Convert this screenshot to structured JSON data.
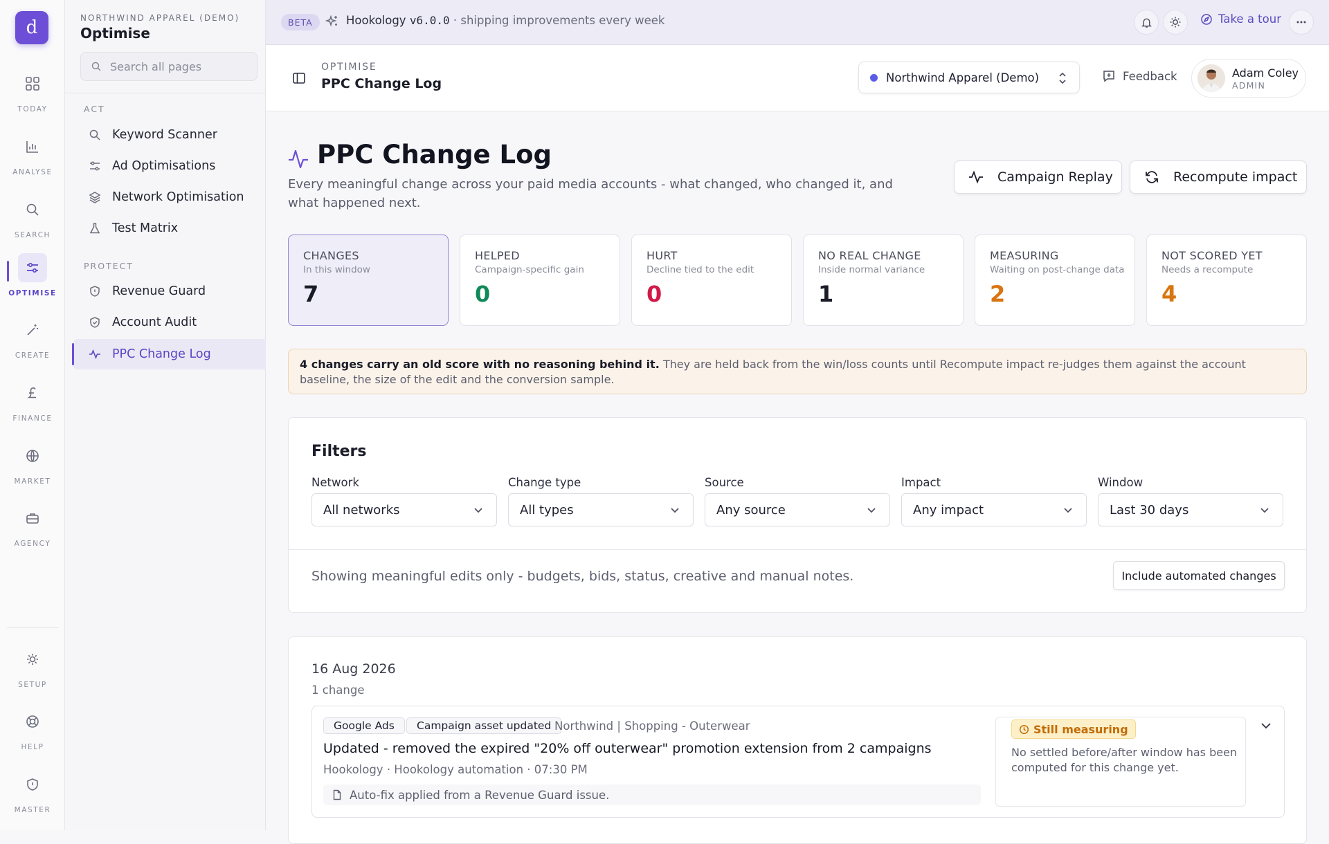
{
  "rail": {
    "logo_letter": "d",
    "items": [
      {
        "label": "TODAY",
        "icon": "grid-icon"
      },
      {
        "label": "ANALYSE",
        "icon": "bar-chart-icon"
      },
      {
        "label": "SEARCH",
        "icon": "search-icon"
      },
      {
        "label": "OPTIMISE",
        "icon": "sliders-icon"
      },
      {
        "label": "CREATE",
        "icon": "wand-icon"
      },
      {
        "label": "FINANCE",
        "icon": "pound-icon"
      },
      {
        "label": "MARKET",
        "icon": "globe-icon"
      },
      {
        "label": "AGENCY",
        "icon": "briefcase-icon"
      },
      {
        "label": "SETUP",
        "icon": "sun-gear-icon"
      },
      {
        "label": "HELP",
        "icon": "lifebuoy-icon"
      },
      {
        "label": "MASTER",
        "icon": "shield-icon"
      }
    ]
  },
  "sidebar": {
    "org": "NORTHWIND APPAREL (DEMO)",
    "section": "Optimise",
    "search_placeholder": "Search all pages",
    "groups": [
      {
        "title": "ACT",
        "items": [
          "Keyword Scanner",
          "Ad Optimisations",
          "Network Optimisation",
          "Test Matrix"
        ]
      },
      {
        "title": "PROTECT",
        "items": [
          "Revenue Guard",
          "Account Audit",
          "PPC Change Log"
        ]
      }
    ],
    "active_item": "PPC Change Log"
  },
  "topbar": {
    "badge": "BETA",
    "brand": "Hookology",
    "version": "v6.0.0",
    "tagline": " · shipping improvements every week",
    "tour": "Take a tour"
  },
  "header": {
    "eyebrow": "OPTIMISE",
    "title": "PPC Change Log",
    "account": "Northwind Apparel (Demo)",
    "feedback": "Feedback",
    "user_name": "Adam Coley",
    "user_role": "ADMIN"
  },
  "page": {
    "title": "PPC Change Log",
    "description": "Every meaningful change across your paid media accounts - what changed, who changed it, and what happened next.",
    "btn_replay": "Campaign Replay",
    "btn_recompute": "Recompute impact"
  },
  "stats": [
    {
      "label": "CHANGES",
      "sub": "In this window",
      "value": "7",
      "color": "#191b27"
    },
    {
      "label": "HELPED",
      "sub": "Campaign-specific gain",
      "value": "0",
      "color": "#12895a"
    },
    {
      "label": "HURT",
      "sub": "Decline tied to the edit",
      "value": "0",
      "color": "#d11a48"
    },
    {
      "label": "NO REAL CHANGE",
      "sub": "Inside normal variance",
      "value": "1",
      "color": "#191b27"
    },
    {
      "label": "MEASURING",
      "sub": "Waiting on post-change data",
      "value": "2",
      "color": "#d97510"
    },
    {
      "label": "NOT SCORED YET",
      "sub": "Needs a recompute",
      "value": "4",
      "color": "#d97510"
    }
  ],
  "notice": {
    "bold": "4 changes carry an old score with no reasoning behind it.",
    "text": " They are held back from the win/loss counts until Recompute impact re-judges them against the account baseline, the size of the edit and the conversion sample."
  },
  "filters": {
    "title": "Filters",
    "fields": [
      {
        "label": "Network",
        "value": "All networks"
      },
      {
        "label": "Change type",
        "value": "All types"
      },
      {
        "label": "Source",
        "value": "Any source"
      },
      {
        "label": "Impact",
        "value": "Any impact"
      },
      {
        "label": "Window",
        "value": "Last 30 days"
      }
    ],
    "note": "Showing meaningful edits only - budgets, bids, status, creative and manual notes.",
    "include_btn": "Include automated changes"
  },
  "log": {
    "date": "16 Aug 2026",
    "count": "1 change",
    "entry": {
      "network": "Google Ads",
      "type": "Campaign asset updated",
      "campaign": "Northwind | Shopping - Outerwear",
      "title": "Updated - removed the expired \"20% off outerwear\" promotion extension from 2 campaigns",
      "meta": "Hookology  · Hookology automation  · 07:30 PM",
      "note": "Auto-fix applied from a Revenue Guard issue.",
      "status": "Still measuring",
      "status_text": "No settled before/after window has been computed for this change yet."
    }
  }
}
